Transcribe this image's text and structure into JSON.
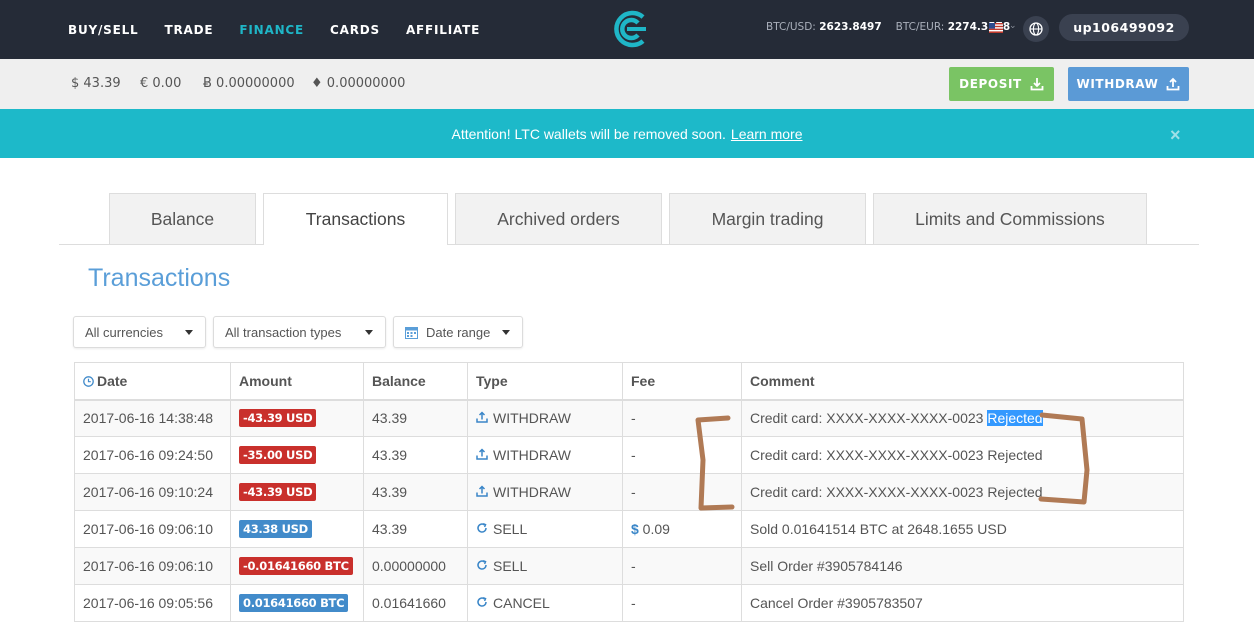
{
  "nav": {
    "items": [
      "BUY/SELL",
      "TRADE",
      "FINANCE",
      "CARDS",
      "AFFILIATE"
    ],
    "active": "FINANCE",
    "rates": {
      "btc_usd_label": "BTC/USD:",
      "btc_usd": "2623.8497",
      "btc_eur_label": "BTC/EUR:",
      "btc_eur": "2274.3578"
    },
    "user": "up106499092"
  },
  "balances": {
    "usd": "$ 43.39",
    "eur": "€ 0.00",
    "btc": "Ƀ 0.00000000",
    "eth": "♦ 0.00000000"
  },
  "buttons": {
    "deposit": "DEPOSIT",
    "withdraw": "WITHDRAW"
  },
  "alert": {
    "text": "Attention! LTC wallets will be removed soon.",
    "link": "Learn more",
    "close": "×"
  },
  "tabs": [
    "Balance",
    "Transactions",
    "Archived orders",
    "Margin trading",
    "Limits and Commissions"
  ],
  "active_tab": "Transactions",
  "page_title": "Transactions",
  "filters": {
    "currency": "All currencies",
    "types": "All transaction types",
    "date": "Date range"
  },
  "table": {
    "headers": [
      "Date",
      "Amount",
      "Balance",
      "Type",
      "Fee",
      "Comment"
    ],
    "rows": [
      {
        "date": "2017-06-16 14:38:48",
        "amount": "-43.39 USD",
        "amount_color": "red",
        "balance": "43.39",
        "type": "WITHDRAW",
        "type_icon": "upload-icon",
        "fee": "-",
        "comment": "Credit card: XXXX-XXXX-XXXX-0023 ",
        "comment_selected": "Rejected"
      },
      {
        "date": "2017-06-16 09:24:50",
        "amount": "-35.00 USD",
        "amount_color": "red",
        "balance": "43.39",
        "type": "WITHDRAW",
        "type_icon": "upload-icon",
        "fee": "-",
        "comment": "Credit card: XXXX-XXXX-XXXX-0023 Rejected",
        "comment_selected": ""
      },
      {
        "date": "2017-06-16 09:10:24",
        "amount": "-43.39 USD",
        "amount_color": "red",
        "balance": "43.39",
        "type": "WITHDRAW",
        "type_icon": "upload-icon",
        "fee": "-",
        "comment": "Credit card: XXXX-XXXX-XXXX-0023 Rejected",
        "comment_selected": ""
      },
      {
        "date": "2017-06-16 09:06:10",
        "amount": "43.38 USD",
        "amount_color": "blue",
        "balance": "43.39",
        "type": "SELL",
        "type_icon": "refresh-icon",
        "fee": "$ 0.09",
        "comment": "Sold 0.01641514 BTC at 2648.1655 USD",
        "comment_selected": ""
      },
      {
        "date": "2017-06-16 09:06:10",
        "amount": "-0.01641660 BTC",
        "amount_color": "red",
        "balance": "0.00000000",
        "type": "SELL",
        "type_icon": "refresh-icon",
        "fee": "-",
        "comment": "Sell Order #3905784146",
        "comment_selected": ""
      },
      {
        "date": "2017-06-16 09:05:56",
        "amount": "0.01641660 BTC",
        "amount_color": "blue",
        "balance": "0.01641660",
        "type": "CANCEL",
        "type_icon": "refresh-icon",
        "fee": "-",
        "comment": "Cancel Order #3905783507",
        "comment_selected": ""
      }
    ]
  },
  "colors": {
    "nav_bg": "#252b37",
    "accent": "#1fb6c7",
    "alert_bg": "#1db9c9",
    "deposit": "#7ac464",
    "withdraw": "#5b9ad6",
    "badge_red": "#c9302c",
    "badge_blue": "#428bca",
    "annotation": "#b07a55"
  }
}
